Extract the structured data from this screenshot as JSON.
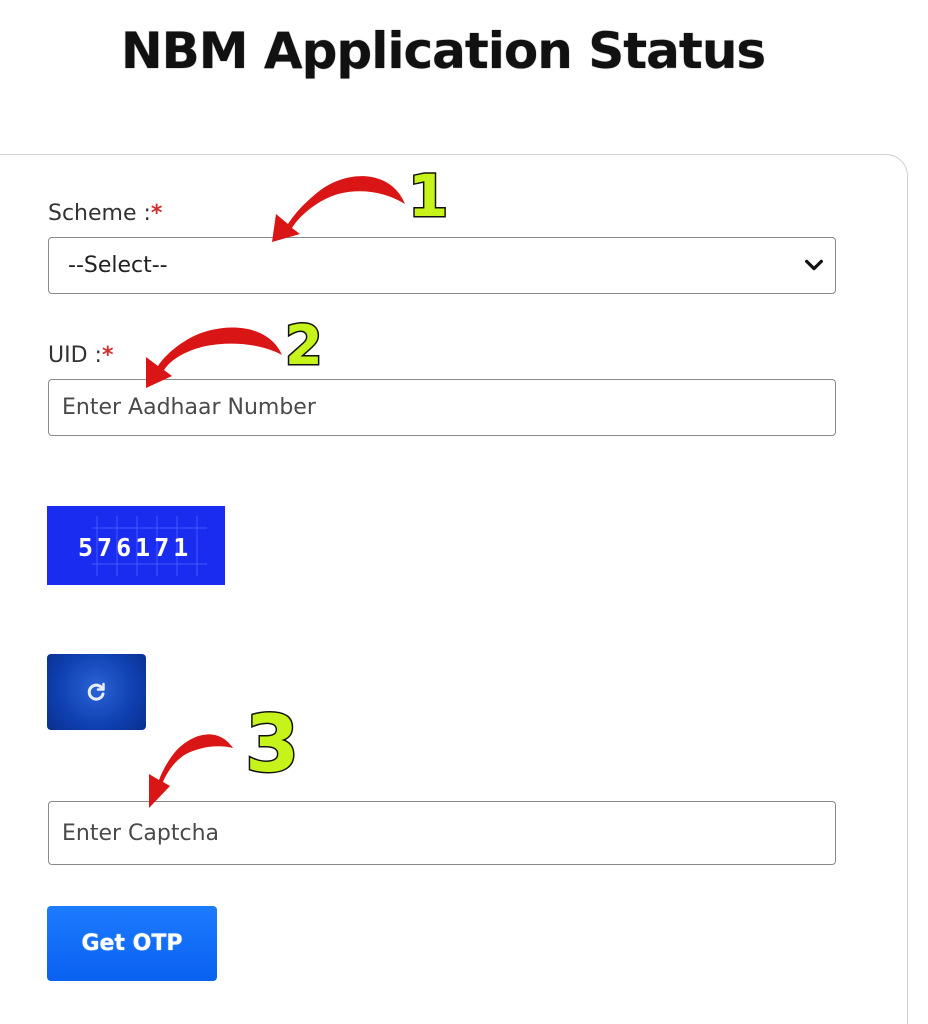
{
  "header": {
    "title": "NBM Application Status"
  },
  "form": {
    "scheme": {
      "label": "Scheme :",
      "required_mark": "*",
      "selected_value": "--Select--"
    },
    "uid": {
      "label": "UID :",
      "required_mark": "*",
      "placeholder": "Enter Aadhaar Number",
      "value": ""
    },
    "captcha": {
      "code": "576171",
      "input_placeholder": "Enter Captcha",
      "input_value": ""
    },
    "refresh_icon": "refresh-icon",
    "submit_label": "Get OTP"
  },
  "annotations": {
    "steps": [
      "1",
      "2",
      "3"
    ],
    "arrow_color": "#d91515",
    "number_color": "#c6f31a"
  },
  "colors": {
    "button_blue": "#0a61f0",
    "captcha_bg": "#1a2cf0",
    "required_red": "#d32f2f"
  }
}
